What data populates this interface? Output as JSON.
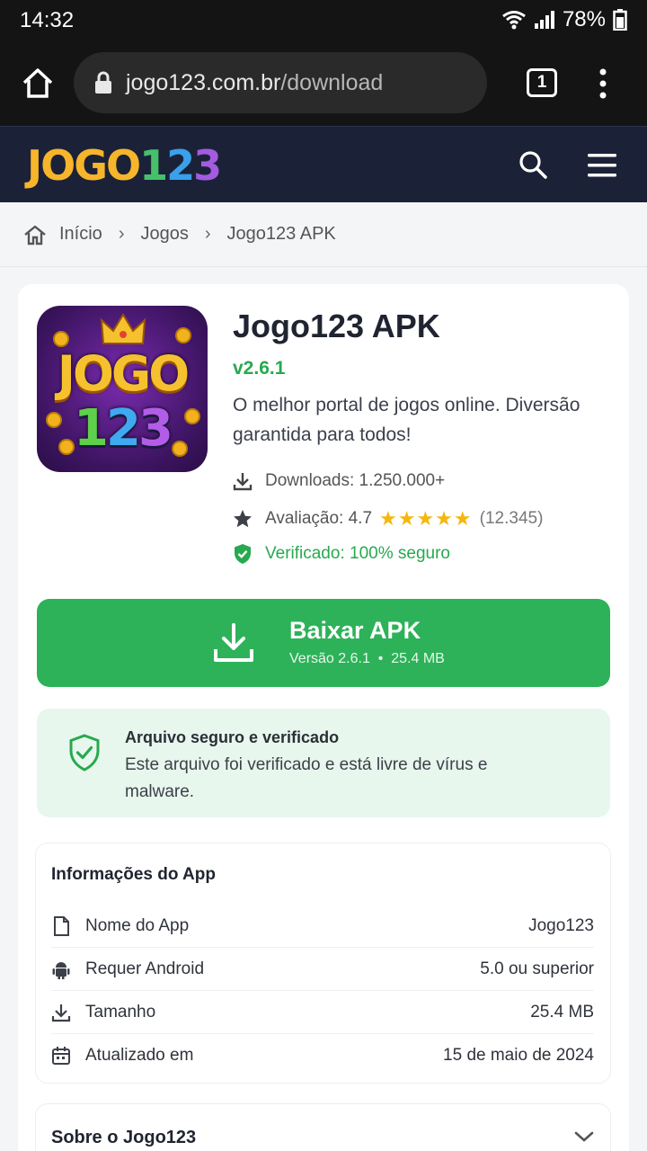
{
  "status_bar": {
    "time": "14:32",
    "battery": "78%"
  },
  "browser": {
    "url_host": "jogo123.com.br",
    "url_path": "/download",
    "tab_count": "1"
  },
  "site": {
    "logo_main": "JOGO",
    "logo_digits": [
      "1",
      "2",
      "3"
    ]
  },
  "breadcrumb": [
    "Início",
    "Jogos",
    "Jogo123 APK"
  ],
  "app": {
    "icon_text_top": "JOGO",
    "icon_text_bottom": [
      "1",
      "2",
      "3"
    ],
    "title": "Jogo123 APK",
    "version": "v2.6.1",
    "description": "O melhor portal de jogos online. Diversão garantida para todos!",
    "downloads": "Downloads: 1.250.000+",
    "rating_label": "Avaliação: 4.7",
    "rating_value": 4.7,
    "rating_stars": "★★★★★",
    "rating_count": "(12.345)",
    "verified": "Verificado: 100% seguro"
  },
  "download_button": {
    "label": "Baixar APK",
    "sub": "Versão 2.6.1  •  25.4 MB"
  },
  "safe_notice": {
    "title": "Arquivo seguro e verificado",
    "text": "Este arquivo foi verificado e está livre de vírus e malware."
  },
  "info": {
    "heading": "Informações do App",
    "rows": [
      {
        "icon": "file-icon",
        "label": "Nome do App",
        "value": "Jogo123"
      },
      {
        "icon": "android-icon",
        "label": "Requer Android",
        "value": "5.0 ou superior"
      },
      {
        "icon": "download-icon",
        "label": "Tamanho",
        "value": "25.4 MB"
      },
      {
        "icon": "calendar-icon",
        "label": "Atualizado em",
        "value": "15 de maio de 2024"
      }
    ]
  },
  "about": {
    "title": "Sobre o Jogo123"
  },
  "colors": {
    "accent": "#2db259",
    "header": "#1b2237",
    "star": "#f5b70f"
  }
}
